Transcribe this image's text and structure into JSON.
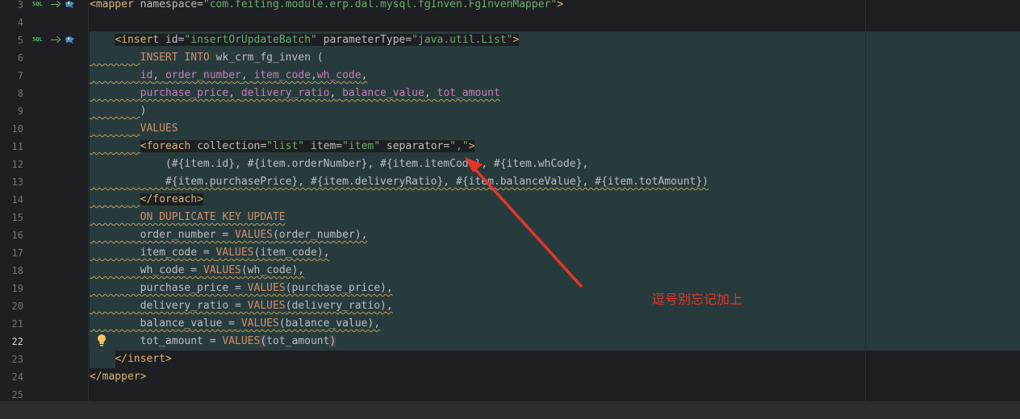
{
  "editor": {
    "caret_line": "22",
    "gutter_labels": {
      "sql": "SQL"
    },
    "lines": [
      {
        "num": "3",
        "segments": [
          {
            "cls": "tag",
            "t": "<mapper"
          },
          {
            "cls": "attr",
            "t": " namespace="
          },
          {
            "cls": "str",
            "t": "\"com.feiting.module.erp.dal.mysql.fgInven.FgInvenMapper\""
          },
          {
            "cls": "tag",
            "t": ">"
          }
        ]
      },
      {
        "num": "4",
        "segments": []
      },
      {
        "num": "5",
        "segments": [
          {
            "cls": "plain",
            "t": "    "
          },
          {
            "cls": "tag tagbg",
            "t": "<insert"
          },
          {
            "cls": "attr tagbg",
            "t": " id="
          },
          {
            "cls": "str tagbg",
            "t": "\"insertOrUpdateBatch\""
          },
          {
            "cls": "attr tagbg",
            "t": " parameterType="
          },
          {
            "cls": "str tagbg",
            "t": "\"java.util.List\""
          },
          {
            "cls": "tag tagbg",
            "t": ">"
          }
        ]
      },
      {
        "num": "6",
        "segments": [
          {
            "cls": "plain warn",
            "t": "        "
          },
          {
            "cls": "kw",
            "t": "INSERT INTO "
          },
          {
            "cls": "plain",
            "t": "wk_crm_fg_inven ("
          }
        ]
      },
      {
        "num": "7",
        "segments": [
          {
            "cls": "plain warn",
            "t": "        "
          },
          {
            "cls": "col warn",
            "t": "id"
          },
          {
            "cls": "plain warn",
            "t": ", "
          },
          {
            "cls": "col warn",
            "t": "order_number"
          },
          {
            "cls": "plain warn",
            "t": ", "
          },
          {
            "cls": "col warn",
            "t": "item_code"
          },
          {
            "cls": "plain warn",
            "t": ","
          },
          {
            "cls": "col warn",
            "t": "wh_code"
          },
          {
            "cls": "plain warn",
            "t": ","
          }
        ]
      },
      {
        "num": "8",
        "segments": [
          {
            "cls": "plain warn",
            "t": "        "
          },
          {
            "cls": "col warn",
            "t": "purchase_price"
          },
          {
            "cls": "plain warn",
            "t": ", "
          },
          {
            "cls": "col warn",
            "t": "delivery_ratio"
          },
          {
            "cls": "plain warn",
            "t": ", "
          },
          {
            "cls": "col warn",
            "t": "balance_value"
          },
          {
            "cls": "plain warn",
            "t": ", "
          },
          {
            "cls": "col warn",
            "t": "tot_amount"
          }
        ]
      },
      {
        "num": "9",
        "segments": [
          {
            "cls": "plain warn",
            "t": "        "
          },
          {
            "cls": "plain",
            "t": ")"
          }
        ]
      },
      {
        "num": "10",
        "segments": [
          {
            "cls": "plain warn",
            "t": "        "
          },
          {
            "cls": "kw",
            "t": "VALUES"
          }
        ]
      },
      {
        "num": "11",
        "segments": [
          {
            "cls": "plain warn",
            "t": "        "
          },
          {
            "cls": "tag tagbg",
            "t": "<foreach"
          },
          {
            "cls": "attr tagbg",
            "t": " collection="
          },
          {
            "cls": "str tagbg",
            "t": "\"list\""
          },
          {
            "cls": "attr tagbg",
            "t": " item="
          },
          {
            "cls": "str tagbg",
            "t": "\"item\""
          },
          {
            "cls": "attr tagbg",
            "t": " separator="
          },
          {
            "cls": "str tagbg",
            "t": "\",\""
          },
          {
            "cls": "tag tagbg",
            "t": ">"
          }
        ]
      },
      {
        "num": "12",
        "segments": [
          {
            "cls": "plain",
            "t": "            (#{item.id}, #{item.orderNumber}, #{item.itemCode}, #{item.whCode},"
          }
        ]
      },
      {
        "num": "13",
        "segments": [
          {
            "cls": "plain warn",
            "t": "            #{item.purchasePrice}, #{item.deliveryRatio}, #{item.balanceValue}, #{item.totAmount})"
          }
        ]
      },
      {
        "num": "14",
        "segments": [
          {
            "cls": "plain warn",
            "t": "        "
          },
          {
            "cls": "tag tagbg",
            "t": "</foreach>"
          }
        ]
      },
      {
        "num": "15",
        "segments": [
          {
            "cls": "plain warn",
            "t": "        "
          },
          {
            "cls": "kw warn",
            "t": "ON DUPLICATE KEY UPDATE"
          }
        ]
      },
      {
        "num": "16",
        "segments": [
          {
            "cls": "plain warn",
            "t": "        order_number = "
          },
          {
            "cls": "kw warn",
            "t": "VALUES"
          },
          {
            "cls": "plain warn",
            "t": "(order_number),"
          }
        ]
      },
      {
        "num": "17",
        "segments": [
          {
            "cls": "plain warn",
            "t": "        item_code = "
          },
          {
            "cls": "kw warn",
            "t": "VALUES"
          },
          {
            "cls": "plain warn",
            "t": "(item_code),"
          }
        ]
      },
      {
        "num": "18",
        "segments": [
          {
            "cls": "plain warn",
            "t": "        wh_code = "
          },
          {
            "cls": "kw warn",
            "t": "VALUES"
          },
          {
            "cls": "plain warn",
            "t": "(wh_code),"
          }
        ]
      },
      {
        "num": "19",
        "segments": [
          {
            "cls": "plain warn",
            "t": "        purchase_price = "
          },
          {
            "cls": "kw warn",
            "t": "VALUES"
          },
          {
            "cls": "plain warn",
            "t": "(purchase_price),"
          }
        ]
      },
      {
        "num": "20",
        "segments": [
          {
            "cls": "plain warn",
            "t": "        delivery_ratio = "
          },
          {
            "cls": "kw warn",
            "t": "VALUES"
          },
          {
            "cls": "plain warn",
            "t": "(delivery_ratio),"
          }
        ]
      },
      {
        "num": "21",
        "segments": [
          {
            "cls": "plain warn",
            "t": "        balance_value = "
          },
          {
            "cls": "kw warn",
            "t": "VALUES"
          },
          {
            "cls": "plain warn",
            "t": "(balance_value),"
          }
        ]
      },
      {
        "num": "22",
        "segments": [
          {
            "cls": "plain",
            "t": "        tot_amount = "
          },
          {
            "cls": "kw",
            "t": "VALUES"
          },
          {
            "cls": "plain matched",
            "t": "("
          },
          {
            "cls": "plain",
            "t": "tot_amount"
          },
          {
            "cls": "plain matched",
            "t": ")"
          }
        ]
      },
      {
        "num": "23",
        "segments": [
          {
            "cls": "plain",
            "t": "    "
          },
          {
            "cls": "tag",
            "t": "</insert>"
          }
        ]
      },
      {
        "num": "24",
        "segments": [
          {
            "cls": "tag",
            "t": "</mapper>"
          }
        ]
      },
      {
        "num": "25",
        "segments": []
      }
    ]
  },
  "annotation": {
    "text": "逗号别忘记加上",
    "color": "#e5342c",
    "icon": "red-arrow"
  },
  "colors": {
    "background": "#1e1f22",
    "selection": "#283b3c",
    "xml_tag": "#d5b778",
    "string": "#6aab73",
    "keyword": "#cf8e6d",
    "column": "#c77dbb"
  }
}
